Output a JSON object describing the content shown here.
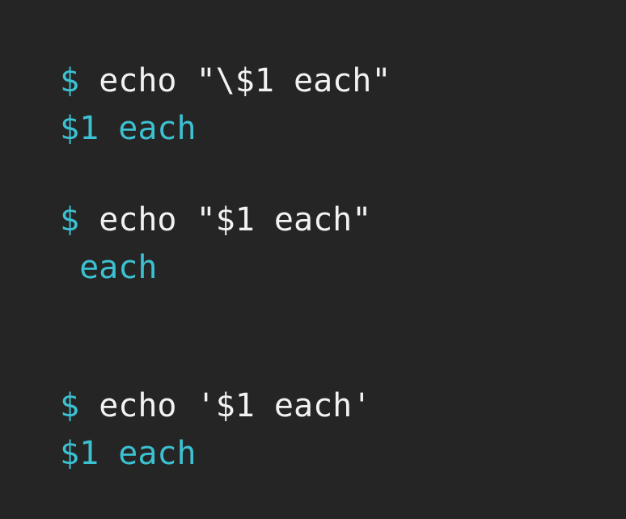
{
  "colors": {
    "background": "#252525",
    "prompt": "#3cc1d2",
    "command": "#f2f2f2",
    "output": "#3cc1d2"
  },
  "prompt_symbol": "$",
  "blocks": [
    {
      "command": "echo \"\\$1 each\"",
      "output": "$1 each"
    },
    {
      "command": "echo \"$1 each\"",
      "output": " each"
    },
    {
      "command": "echo '$1 each'",
      "output": "$1 each"
    }
  ]
}
